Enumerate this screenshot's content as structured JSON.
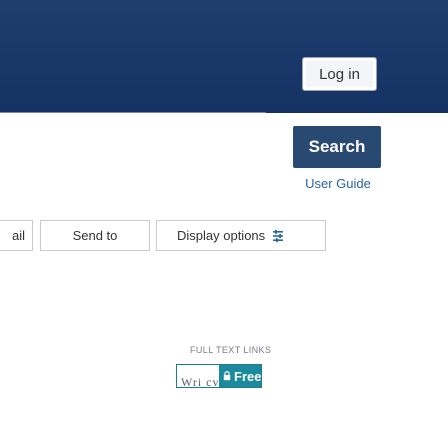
{
  "header": {
    "login_label": "Log in"
  },
  "search": {
    "button_label": "Search",
    "user_guide_label": "User Guide"
  },
  "toolbar": {
    "email_label": "ail",
    "send_to_label": "Send to",
    "display_options_label": "Display options"
  },
  "full_text_links": {
    "heading": "FULL TEXT LINKS",
    "provider_text": "Wri cv",
    "free_label": "Free"
  },
  "colors": {
    "banner": "#1e3e70",
    "search_button": "#284972",
    "link": "#2a63a8",
    "free_badge": "#1a8a9c"
  },
  "icons": {
    "display_options": "gear-icon",
    "free_badge": "lock-icon"
  }
}
